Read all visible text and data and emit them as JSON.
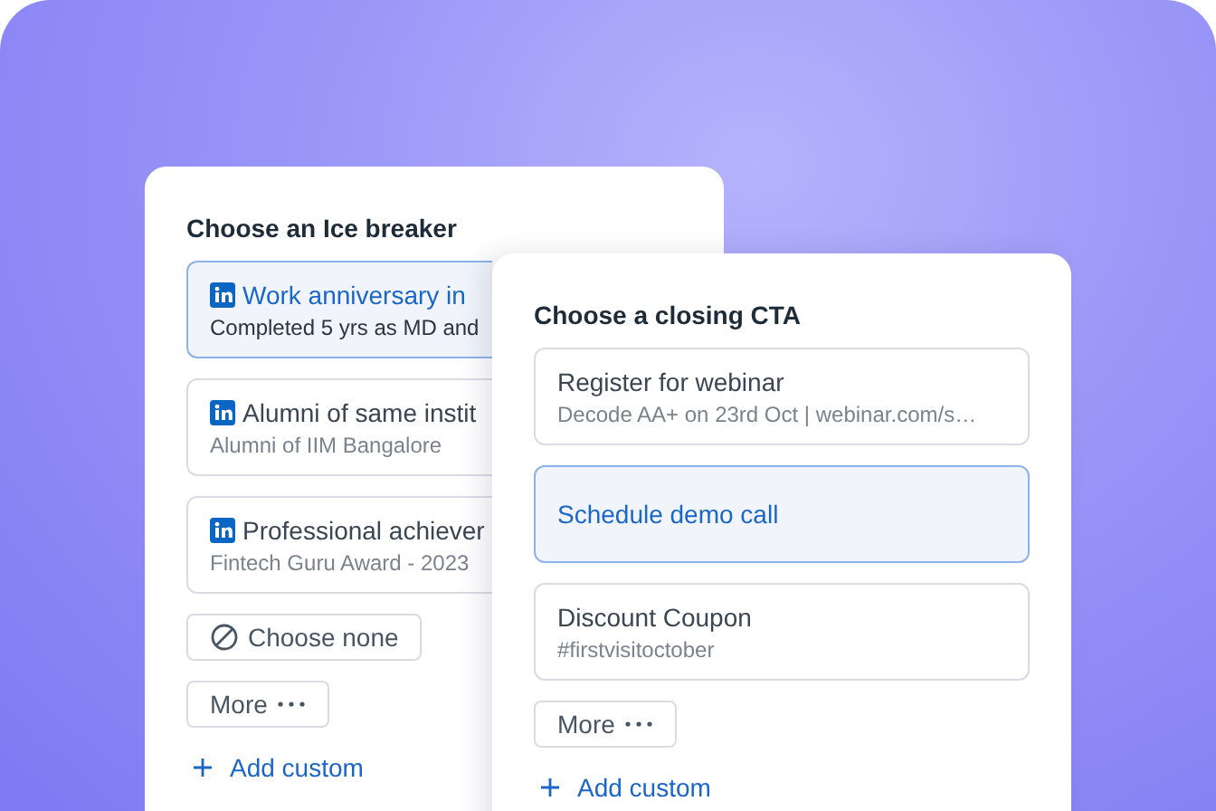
{
  "ice_breaker": {
    "title": "Choose an Ice breaker",
    "options": [
      {
        "kind": "linkedin",
        "title": "Work anniversary in",
        "subtitle": "Completed 5 yrs as MD and",
        "selected": true
      },
      {
        "kind": "linkedin",
        "title": "Alumni of same instit",
        "subtitle": "Alumni of IIM Bangalore",
        "selected": false
      },
      {
        "kind": "linkedin",
        "title": "Professional achiever",
        "subtitle": "Fintech Guru Award - 2023",
        "selected": false
      }
    ],
    "choose_none": "Choose none",
    "more": "More",
    "add_custom": "Add custom"
  },
  "closing_cta": {
    "title": "Choose a closing CTA",
    "options": [
      {
        "title": "Register for webinar",
        "subtitle": "Decode AA+ on 23rd Oct | webinar.com/s…",
        "selected": false
      },
      {
        "title": "Schedule demo call",
        "selected": true
      },
      {
        "title": "Discount Coupon",
        "subtitle": "#firstvisitoctober",
        "selected": false
      }
    ],
    "more": "More",
    "add_custom": "Add custom"
  }
}
